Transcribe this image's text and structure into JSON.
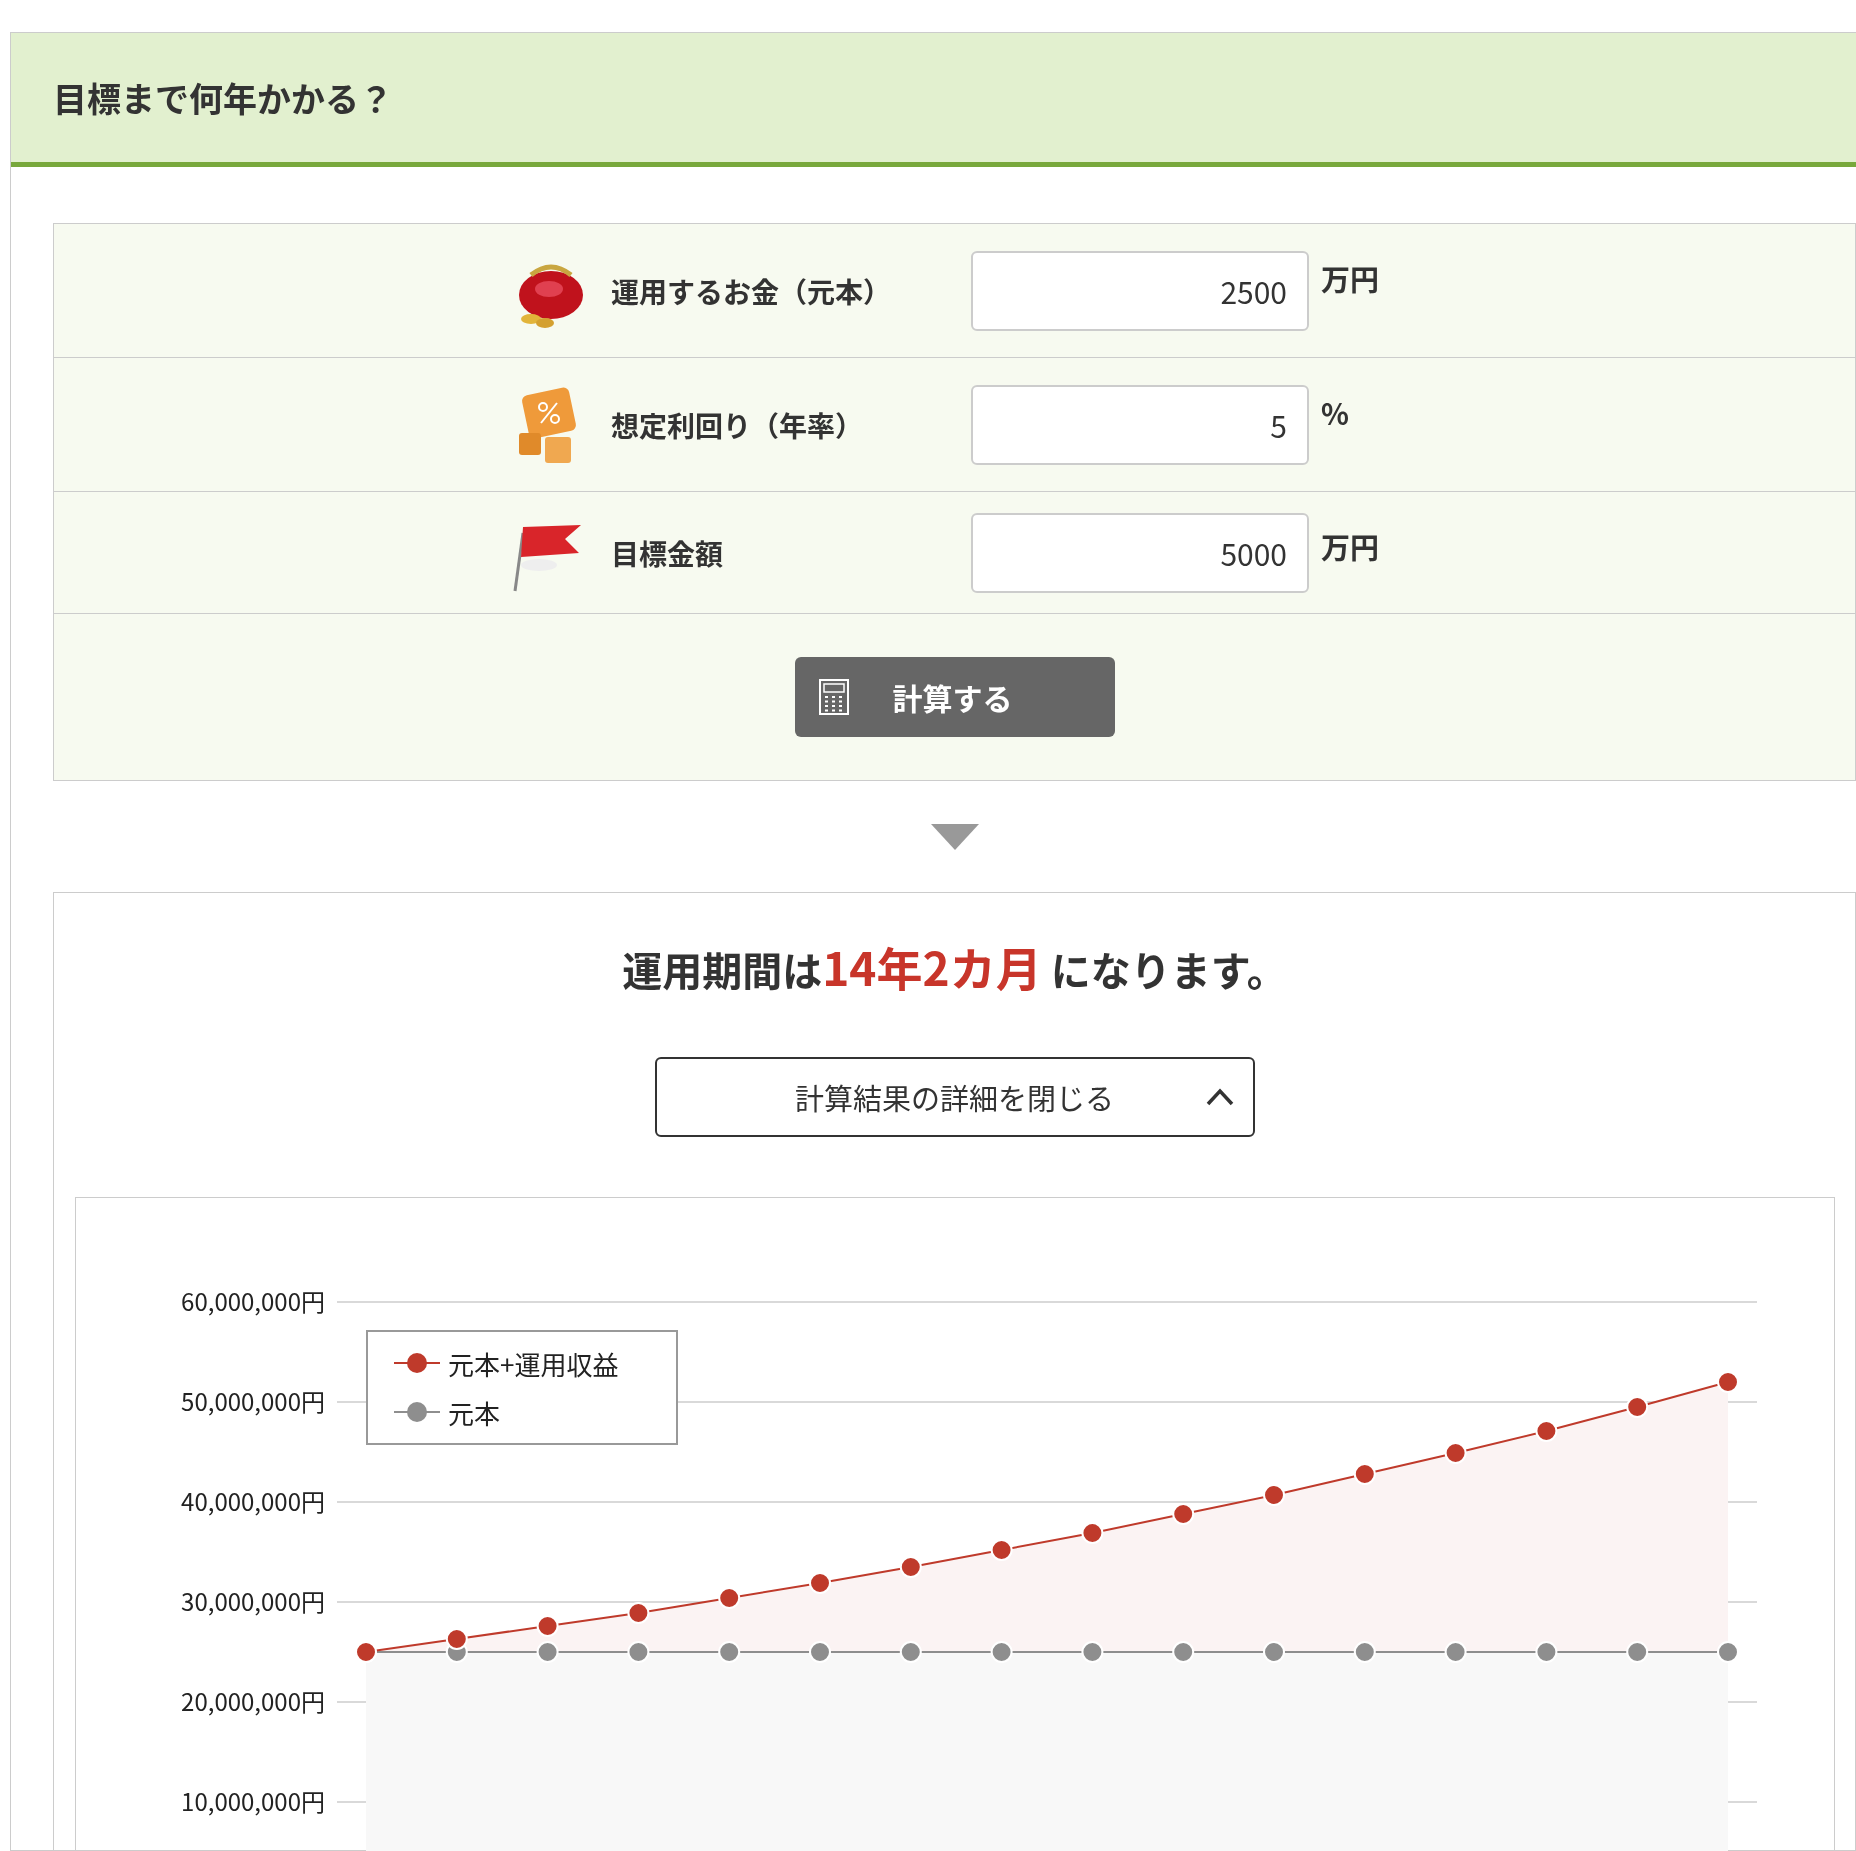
{
  "header": {
    "title": "目標まで何年かかる？"
  },
  "form": {
    "rows": [
      {
        "kind": "purse",
        "label": "運用するお金（元本）",
        "value": "2500",
        "unit": "万円"
      },
      {
        "kind": "percent",
        "label": "想定利回り（年率）",
        "value": "5",
        "unit": "%"
      },
      {
        "kind": "flag",
        "label": "目標金額",
        "value": "5000",
        "unit": "万円"
      }
    ],
    "submit": "計算する"
  },
  "result": {
    "prefix": "運用期間は",
    "highlight": "14年2カ月",
    "suffix": " になります。",
    "toggle": {
      "label": "計算結果の詳細を閉じる",
      "expanded": true
    },
    "chart_data": {
      "type": "area",
      "grid": true,
      "legend": true,
      "ylim": [
        0,
        60000000
      ],
      "yticks": [
        {
          "value": 10000000,
          "label": "10,000,000円"
        },
        {
          "value": 20000000,
          "label": "20,000,000円"
        },
        {
          "value": 30000000,
          "label": "30,000,000円"
        },
        {
          "value": 40000000,
          "label": "40,000,000円"
        },
        {
          "value": 50000000,
          "label": "50,000,000円"
        },
        {
          "value": 60000000,
          "label": "60,000,000円"
        }
      ],
      "series": [
        {
          "name": "元本+運用収益",
          "color": "#bf3a2b",
          "values": [
            25000000,
            26300000,
            27600000,
            28900000,
            30400000,
            31900000,
            33500000,
            35200000,
            36900000,
            38800000,
            40700000,
            42800000,
            44900000,
            47100000,
            49500000,
            52000000
          ]
        },
        {
          "name": "元本",
          "color": "#8e8e8e",
          "values": [
            25000000,
            25000000,
            25000000,
            25000000,
            25000000,
            25000000,
            25000000,
            25000000,
            25000000,
            25000000,
            25000000,
            25000000,
            25000000,
            25000000,
            25000000,
            25000000
          ]
        }
      ]
    }
  }
}
